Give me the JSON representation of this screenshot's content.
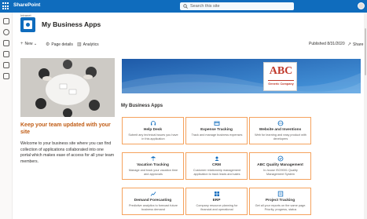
{
  "topbar": {
    "app_name": "SharePoint",
    "search_placeholder": "Search this site"
  },
  "site": {
    "breadcrumb": "Intranet",
    "title": "My Business Apps"
  },
  "commandbar": {
    "new_label": "New",
    "page_details_label": "Page details",
    "analytics_label": "Analytics",
    "published_label": "Published 8/31/2020",
    "share_label": "Share"
  },
  "banner_logo": {
    "brand": "ABC",
    "tagline": "Generic Company"
  },
  "apps_section": {
    "title": "My Business Apps"
  },
  "promo": {
    "title": "Keep your team updated with your site",
    "body": "Welcome to your business site where you can find collection of applications collaborated into one portal which makes ease of access for all your team members."
  },
  "apps": [
    {
      "name": "Help Desk",
      "desc": "Submit any technical issues you have in this application",
      "icon": "headset-icon"
    },
    {
      "name": "Expense Tracking",
      "desc": "Track and manage business expenses",
      "icon": "expense-icon"
    },
    {
      "name": "Website and Inventions",
      "desc": "Web for learning and easy product with developers",
      "icon": "website-icon"
    },
    {
      "name": "Vacation Tracking",
      "desc": "Manage and track your vacation time and approvals",
      "icon": "vacation-icon"
    },
    {
      "name": "CRM",
      "desc": "Customer relationship management application to track leads and sales",
      "icon": "crm-icon"
    },
    {
      "name": "ABC Quality Management",
      "desc": "In-house ISO9001 Quality Management System",
      "icon": "quality-icon"
    },
    {
      "name": "Demand Forecasting",
      "desc": "Predictive analytics to forecast future business demand",
      "icon": "forecast-icon"
    },
    {
      "name": "ERP",
      "desc": "Company resource planning for financial and operational",
      "icon": "erp-icon"
    },
    {
      "name": "Project Tracking",
      "desc": "Get all your reports on the same page. Priority, progress, status",
      "icon": "project-icon"
    }
  ],
  "colors": {
    "suite_bar": "#0f6cbd",
    "accent_orange": "#c05c14",
    "card_border": "#f5a25d",
    "banner_blue": "#2b6fc2"
  }
}
